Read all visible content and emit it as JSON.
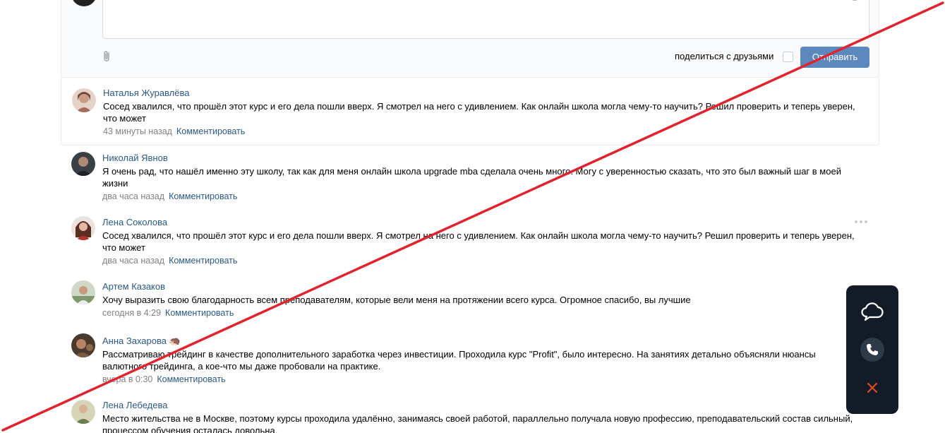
{
  "composer": {
    "share_label": "поделиться с друзьями",
    "send_label": "Отправить"
  },
  "comments": [
    {
      "author": "Наталья Журавлёва",
      "text": "Сосед хвалился, что прошёл этот курс и его дела пошли вверх. Я смотрел на него с удивлением. Как онлайн школа могла чему-то научить? Решил проверить и теперь уверен, что может",
      "time": "43 минуты назад",
      "reply": "Комментировать"
    },
    {
      "author": "Николай Явнов",
      "text": "Я очень рад, что нашёл именно эту школу, так как для меня онлайн школа upgrade mba сделала очень много. Могу с уверенностью сказать, что это был важный шаг в моей жизни",
      "time": "два часа назад",
      "reply": "Комментировать"
    },
    {
      "author": "Лена Соколова",
      "text": "Сосед хвалился, что прошёл этот курс и его дела пошли вверх. Я смотрел на него с удивлением. Как онлайн школа могла чему-то научить? Решил проверить и теперь уверен, что может",
      "time": "два часа назад",
      "reply": "Комментировать"
    },
    {
      "author": "Артем Казаков",
      "text": "Хочу выразить свою благодарность всем преподавателям, которые вели меня на протяжении всего курса. Огромное спасибо, вы лучшие",
      "time": "сегодня в 4:29",
      "reply": "Комментировать"
    },
    {
      "author": "Анна Захарова 🦔",
      "text": "Рассматриваю трейдинг в качестве дополнительного заработка через инвестиции. Проходила курс \"Profit\", было интересно. На занятиях детально объясняли нюансы валютного трейдинга, а кое-что мы даже пробовали на практике.",
      "time": "вчера в 0:30",
      "reply": "Комментировать"
    },
    {
      "author": "Лена Лебедева",
      "text": "Место жительства не в Москве, поэтому курсы проходила удалённо, занимаясь своей работой, параллельно получала новую профессию, преподавательский состав сильный, процессом обучения осталась довольна.",
      "time": "",
      "reply": ""
    }
  ],
  "colors": {
    "link": "#2a5885",
    "button": "#5b88bd",
    "widget_bg": "#131b26",
    "strike_line": "#e0232e",
    "close": "#e0492a"
  },
  "icons": {
    "widget": [
      "cloud-icon",
      "phone-icon",
      "close-icon"
    ],
    "composer": [
      "paperclip-icon",
      "emoji-icon"
    ],
    "comment": [
      "more-icon"
    ]
  }
}
